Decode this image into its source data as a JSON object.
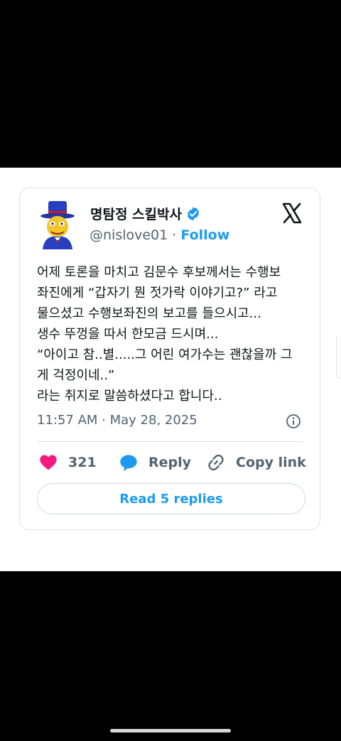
{
  "tweet": {
    "display_name": "명탐정 스킬박사",
    "handle": "@nislove01",
    "separator": "·",
    "follow_label": "Follow",
    "text": "어제 토론을 마치고 김문수 후보께서는 수행보\n좌진에게 “갑자기 뭔 젓가락 이야기고?” 라고\n물으셨고 수행보좌진의 보고를 들으시고...\n생수 뚜껑을 따서 한모금 드시며...\n“아이고 참..별.....그 어린 여가수는 괜찮을까 그\n게 걱정이네..”\n라는 취지로 말씀하셨다고 합니다..",
    "timestamp": "11:57 AM · May 28, 2025",
    "likes": "321",
    "reply_label": "Reply",
    "copy_label": "Copy link",
    "read_replies_label": "Read 5 replies"
  },
  "colors": {
    "accent": "#1d9bf0",
    "like": "#f91880",
    "text": "#0f1419",
    "muted": "#536471"
  },
  "icons": [
    "avatar-cartoon",
    "verified-badge-icon",
    "x-logo-icon",
    "info-icon",
    "heart-icon",
    "reply-bubble-icon",
    "link-icon"
  ]
}
